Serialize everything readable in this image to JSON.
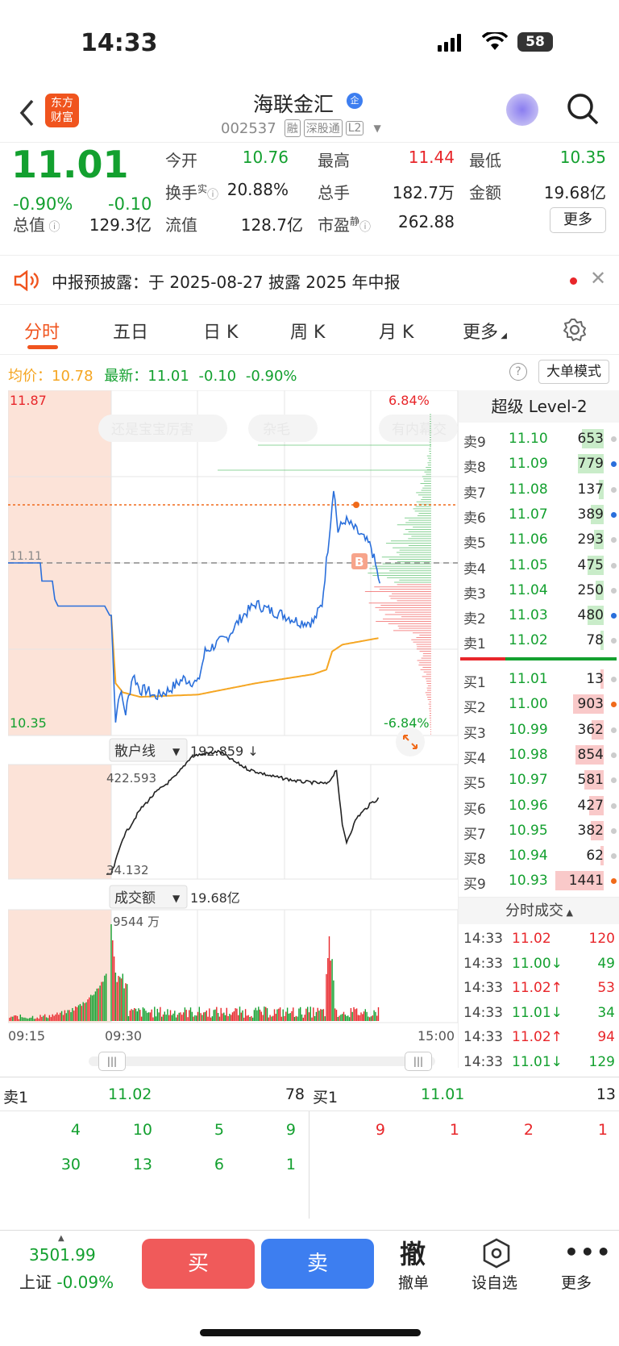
{
  "status": {
    "time": "14:33",
    "battery": "58"
  },
  "nav": {
    "title": "海联金汇",
    "badge": "企",
    "code": "002537",
    "tags": [
      "融",
      "深股通",
      "L2"
    ],
    "logo": [
      "东方",
      "财富"
    ]
  },
  "quote": {
    "price": "11.01",
    "change_pct": "-0.90%",
    "change": "-0.10",
    "fields": [
      {
        "label": "今开",
        "value": "10.76"
      },
      {
        "label": "最高",
        "value": "11.44"
      },
      {
        "label": "最低",
        "value": "10.35"
      },
      {
        "label": "换手",
        "sup": "实",
        "value": "20.88%"
      },
      {
        "label": "总手",
        "value": "182.7万"
      },
      {
        "label": "金额",
        "value": "19.68亿"
      },
      {
        "label": "总值",
        "value": "129.3亿"
      },
      {
        "label": "流值",
        "value": "128.7亿"
      },
      {
        "label": "市盈",
        "sup": "静",
        "value": "262.88"
      }
    ],
    "more": "更多"
  },
  "notice": {
    "text": "中报预披露：于 2025-08-27 披露 2025 年中报"
  },
  "tabs": [
    "分时",
    "五日",
    "日 K",
    "周 K",
    "月 K",
    "更多"
  ],
  "chartinfo": {
    "avg_label": "均价：",
    "avg": "10.78",
    "last_label": "最新：",
    "last": "11.01",
    "chg": "-0.10",
    "pct": "-0.90%",
    "mode": "大单模式"
  },
  "main_chart": {
    "high": "11.87",
    "low": "10.35",
    "pct_high": "6.84%",
    "pct_low": "-6.84%",
    "prev_close": "11.11",
    "watermarks": [
      "还是宝宝厉害",
      "杂毛",
      "有内幕交"
    ],
    "buy_marker": "B"
  },
  "sub1": {
    "selector": "散户线",
    "value": "192.859 ↓",
    "top": "422.593",
    "bottom": "34.132"
  },
  "sub2": {
    "selector": "成交额",
    "value": "19.68亿",
    "top": "9544 万"
  },
  "time_axis": [
    "09:15",
    "09:30",
    "15:00"
  ],
  "level2": {
    "title": "超级 Level-2",
    "asks": [
      {
        "l": "卖9",
        "p": "11.10",
        "v": "653",
        "w": 0.45,
        "dot": "#ccc"
      },
      {
        "l": "卖8",
        "p": "11.09",
        "v": "779",
        "w": 0.54,
        "dot": "#2a6fdb"
      },
      {
        "l": "卖7",
        "p": "11.08",
        "v": "137",
        "w": 0.1,
        "dot": "#ccc"
      },
      {
        "l": "卖6",
        "p": "11.07",
        "v": "389",
        "w": 0.27,
        "dot": "#2a6fdb"
      },
      {
        "l": "卖5",
        "p": "11.06",
        "v": "293",
        "w": 0.2,
        "dot": "#ccc"
      },
      {
        "l": "卖4",
        "p": "11.05",
        "v": "475",
        "w": 0.33,
        "dot": "#ccc"
      },
      {
        "l": "卖3",
        "p": "11.04",
        "v": "250",
        "w": 0.17,
        "dot": "#ccc"
      },
      {
        "l": "卖2",
        "p": "11.03",
        "v": "480",
        "w": 0.33,
        "dot": "#2a6fdb"
      },
      {
        "l": "卖1",
        "p": "11.02",
        "v": "78",
        "w": 0.05,
        "dot": "#ccc"
      }
    ],
    "bids": [
      {
        "l": "买1",
        "p": "11.01",
        "v": "13",
        "w": 0.01,
        "dot": "#ccc"
      },
      {
        "l": "买2",
        "p": "11.00",
        "v": "903",
        "w": 0.63,
        "dot": "#f06a1a"
      },
      {
        "l": "买3",
        "p": "10.99",
        "v": "362",
        "w": 0.25,
        "dot": "#ccc"
      },
      {
        "l": "买4",
        "p": "10.98",
        "v": "854",
        "w": 0.59,
        "dot": "#ccc"
      },
      {
        "l": "买5",
        "p": "10.97",
        "v": "581",
        "w": 0.4,
        "dot": "#ccc"
      },
      {
        "l": "买6",
        "p": "10.96",
        "v": "427",
        "w": 0.3,
        "dot": "#ccc"
      },
      {
        "l": "买7",
        "p": "10.95",
        "v": "382",
        "w": 0.27,
        "dot": "#ccc"
      },
      {
        "l": "买8",
        "p": "10.94",
        "v": "62",
        "w": 0.04,
        "dot": "#ccc"
      },
      {
        "l": "买9",
        "p": "10.93",
        "v": "1441",
        "w": 1,
        "dot": "#f06a1a"
      }
    ],
    "trades_title": "分时成交",
    "trades": [
      {
        "t": "14:33",
        "p": "11.02",
        "v": "120",
        "c": "r"
      },
      {
        "t": "14:33",
        "p": "11.00↓",
        "v": "49",
        "c": "g"
      },
      {
        "t": "14:33",
        "p": "11.02↑",
        "v": "53",
        "c": "r"
      },
      {
        "t": "14:33",
        "p": "11.01↓",
        "v": "34",
        "c": "g"
      },
      {
        "t": "14:33",
        "p": "11.02↑",
        "v": "94",
        "c": "r"
      },
      {
        "t": "14:33",
        "p": "11.01↓",
        "v": "129",
        "c": "g"
      }
    ]
  },
  "bottom": {
    "ask_label": "卖1",
    "ask_price": "11.02",
    "ask_vol": "78",
    "bid_label": "买1",
    "bid_price": "11.01",
    "bid_vol": "13",
    "ask_rows": [
      [
        "4",
        "10",
        "5",
        "9"
      ],
      [
        "30",
        "13",
        "6",
        "1"
      ]
    ],
    "bid_rows": [
      [
        "9",
        "1",
        "2",
        "1"
      ]
    ]
  },
  "actionbar": {
    "index_value": "3501.99",
    "index_name": "上证",
    "index_pct": "-0.09%",
    "buy": "买",
    "sell": "卖",
    "cancel_icon": "撤",
    "cancel": "撤单",
    "fav": "设自选",
    "more": "更多"
  }
}
